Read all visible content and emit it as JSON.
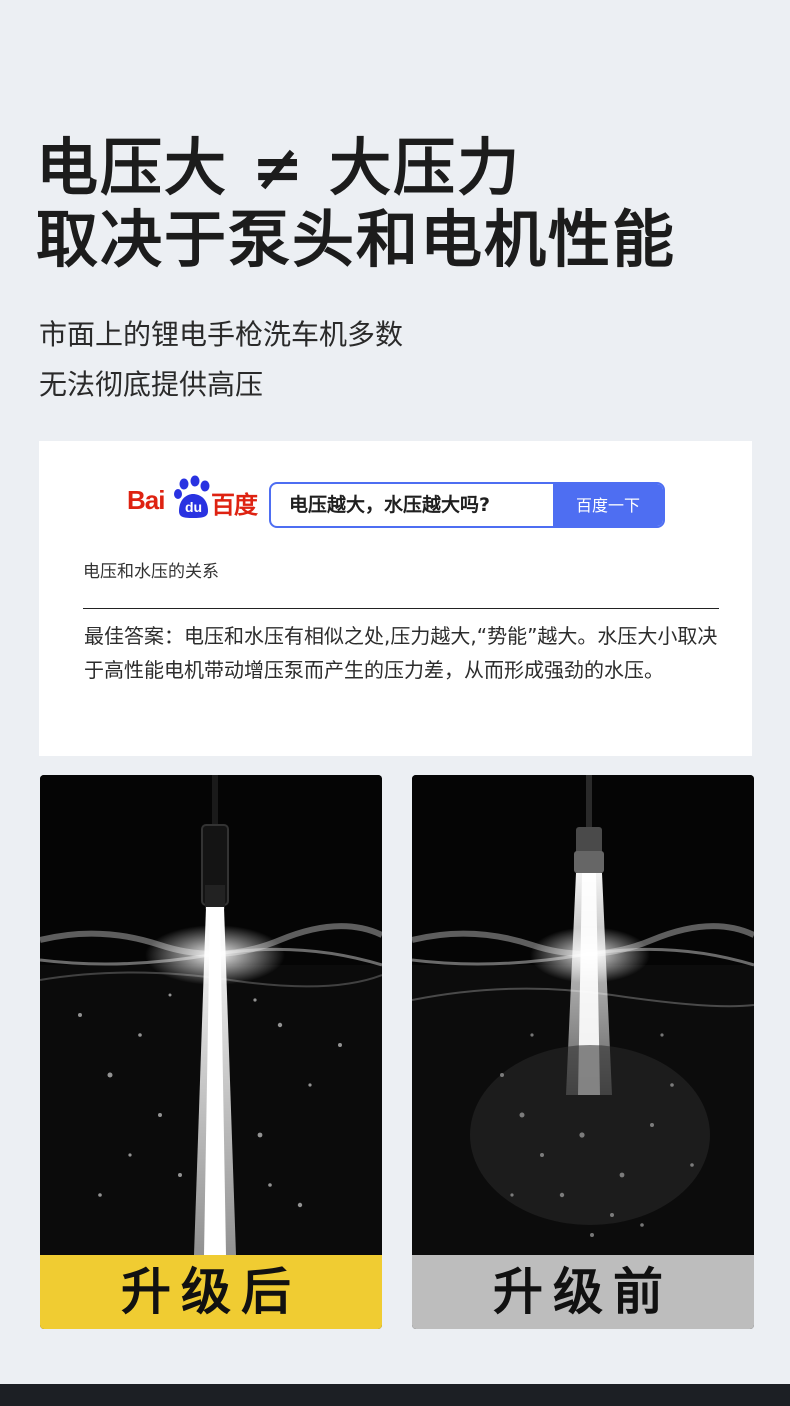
{
  "headline": {
    "line1": "电压大 ≠ 大压力",
    "line2": "取决于泵头和电机性能"
  },
  "subtitle": {
    "line1": "市面上的锂电手枪洗车机多数",
    "line2": "无法彻底提供高压"
  },
  "baidu": {
    "logo_latin": "Bai",
    "logo_du": "du",
    "logo_cn": "百度",
    "search_query": "电压越大，水压越大吗?",
    "search_button": "百度一下",
    "result_title": "电压和水压的关系",
    "result_body": "最佳答案：电压和水压有相似之处,压力越大,“势能”越大。水压大小取决于高性能电机带动增压泵而产生的压力差，从而形成强劲的水压。",
    "brand_color": "#de2211",
    "accent_color": "#4e6ef2"
  },
  "comparison": {
    "after_label": "升级后",
    "before_label": "升级前",
    "after_color": "#f0cc32",
    "before_color": "#bdbdbd"
  }
}
